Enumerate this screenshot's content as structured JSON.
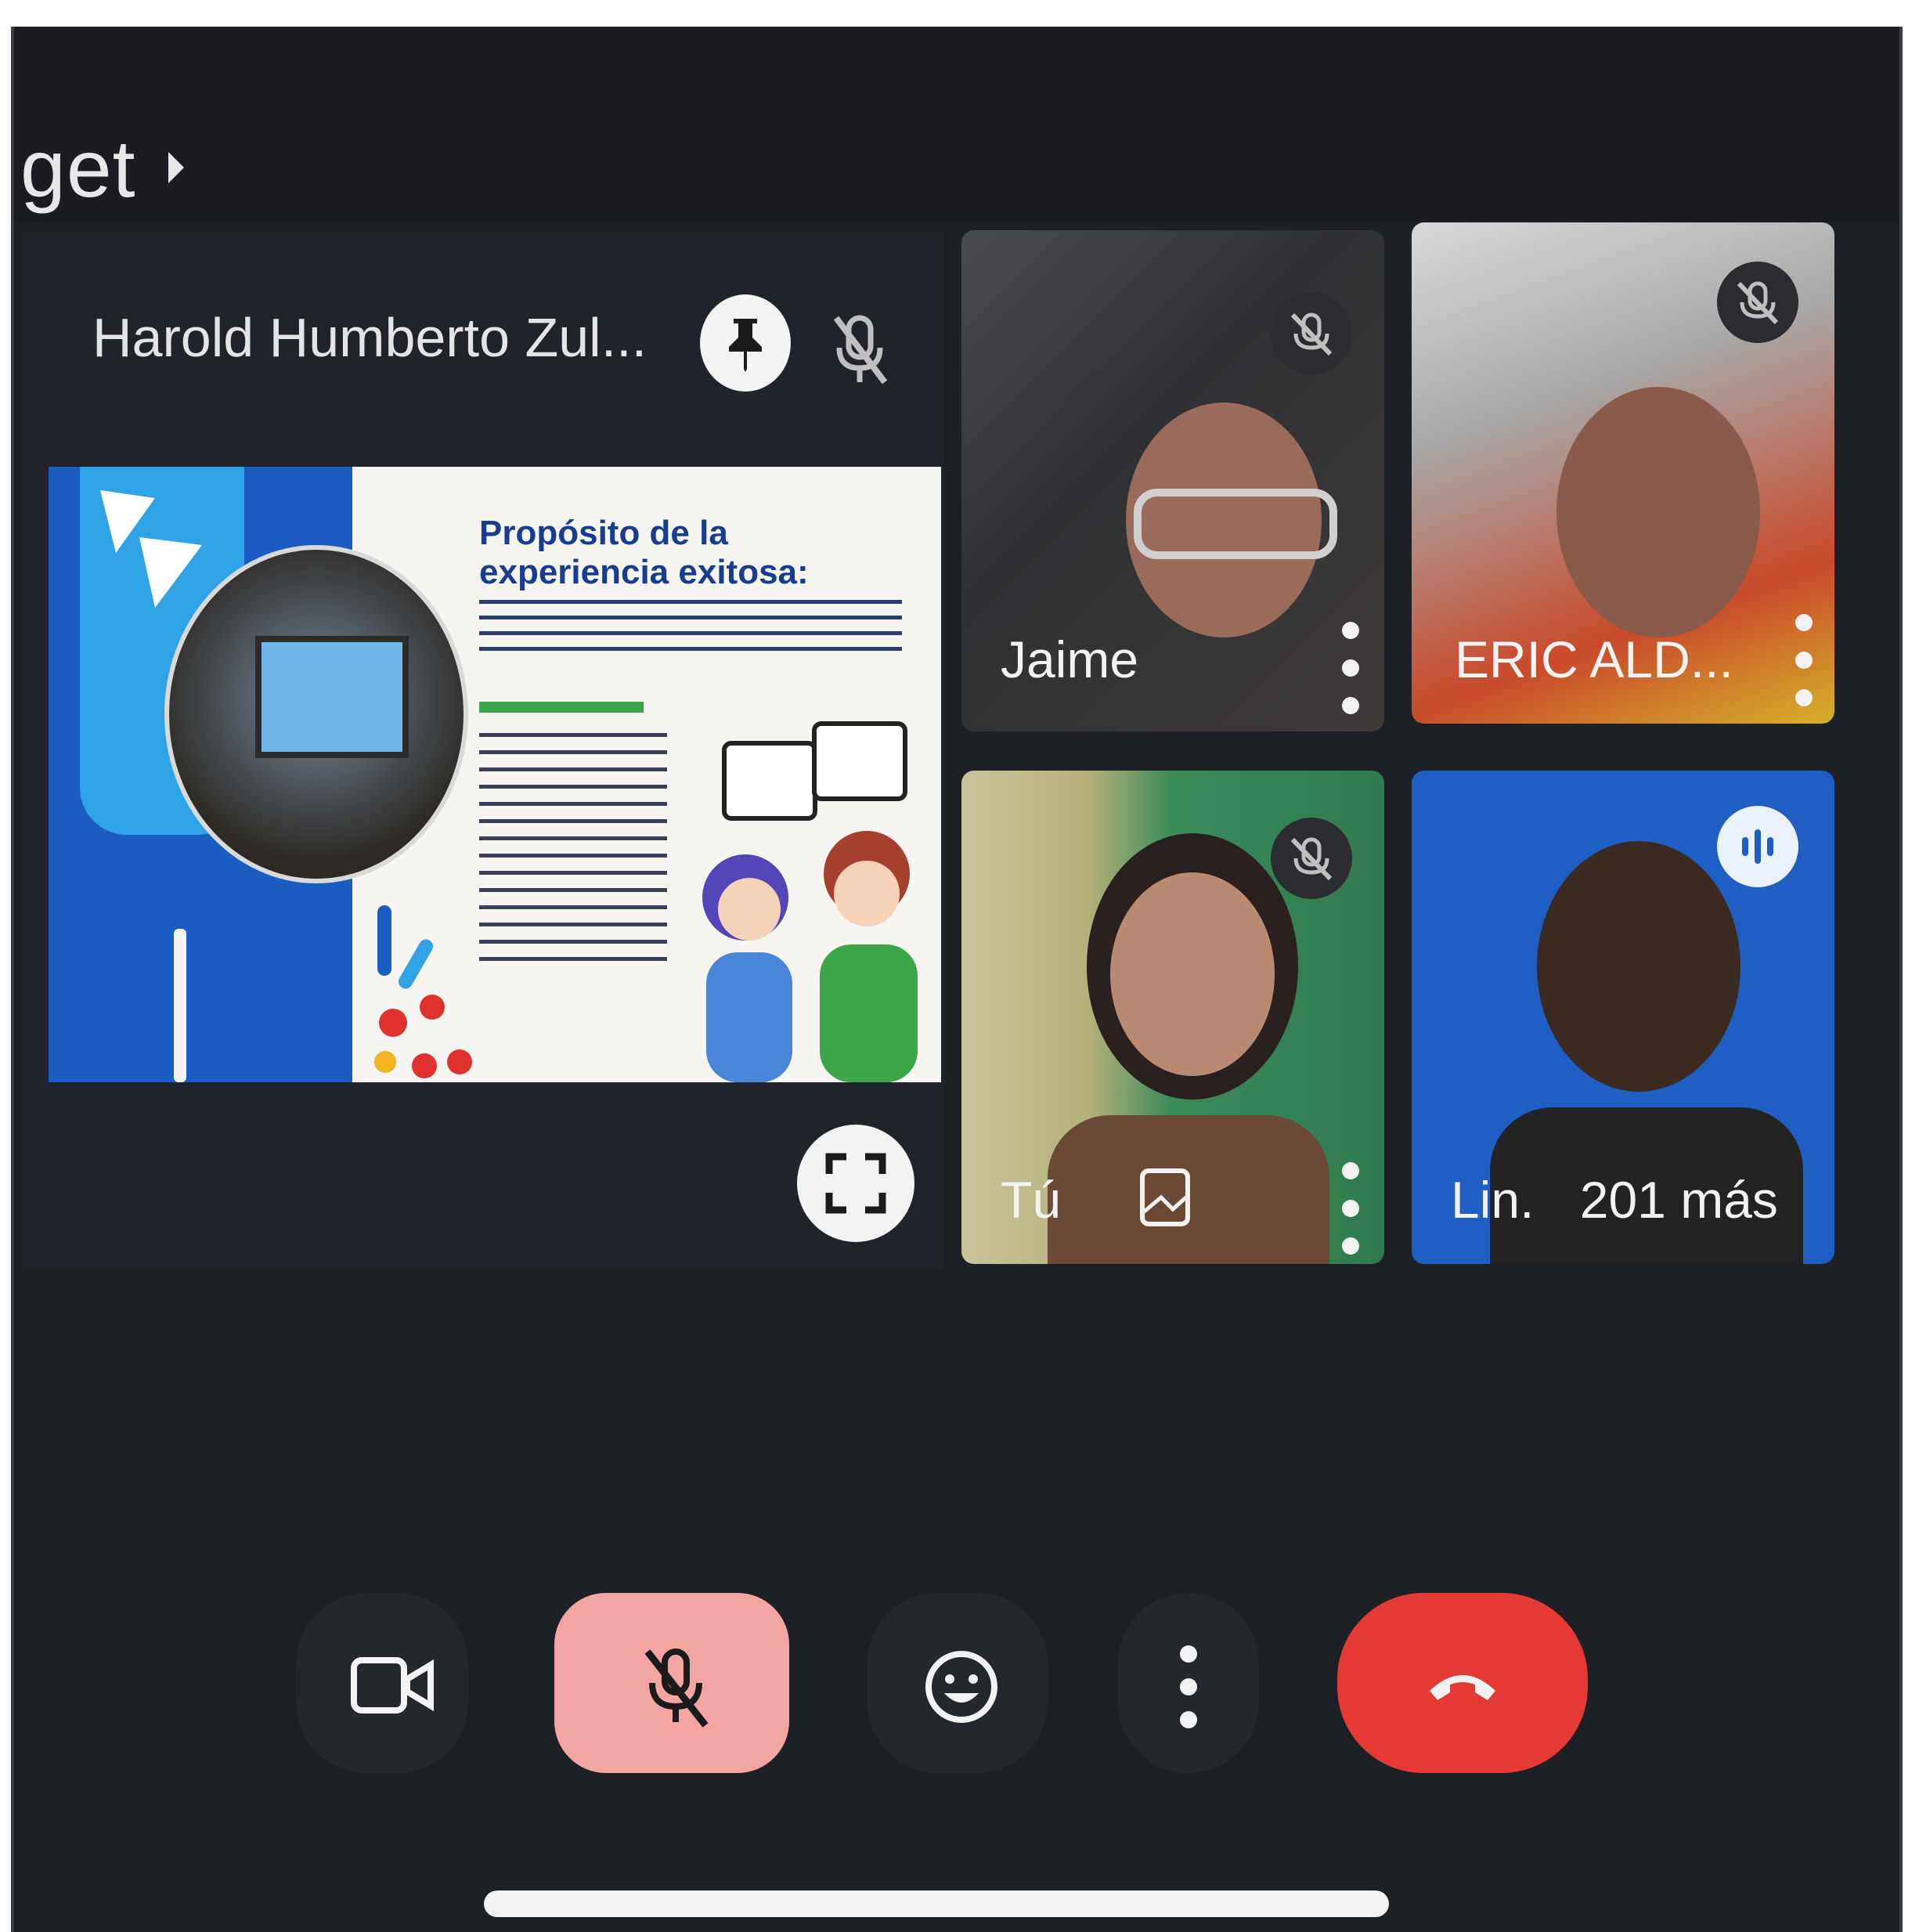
{
  "app": {
    "title": "get"
  },
  "presenter": {
    "name": "Harold Humberto Zul...",
    "slide": {
      "title": "Propósito de la experiencia exitosa:"
    }
  },
  "participants": [
    {
      "name": "Jaime",
      "muted": true
    },
    {
      "name": "ERIC ALD...",
      "muted": true
    },
    {
      "name": "Tú",
      "muted": true
    },
    {
      "name": "Lin.",
      "extra": "201 más"
    }
  ],
  "colors": {
    "background": "#1d2025",
    "mic_button": "#f3a5a2",
    "end_call": "#e53935"
  },
  "controls": {
    "icons": [
      "video-camera-icon",
      "microphone-off-icon",
      "emoji-icon",
      "more-vert-icon",
      "end-call-icon"
    ]
  }
}
